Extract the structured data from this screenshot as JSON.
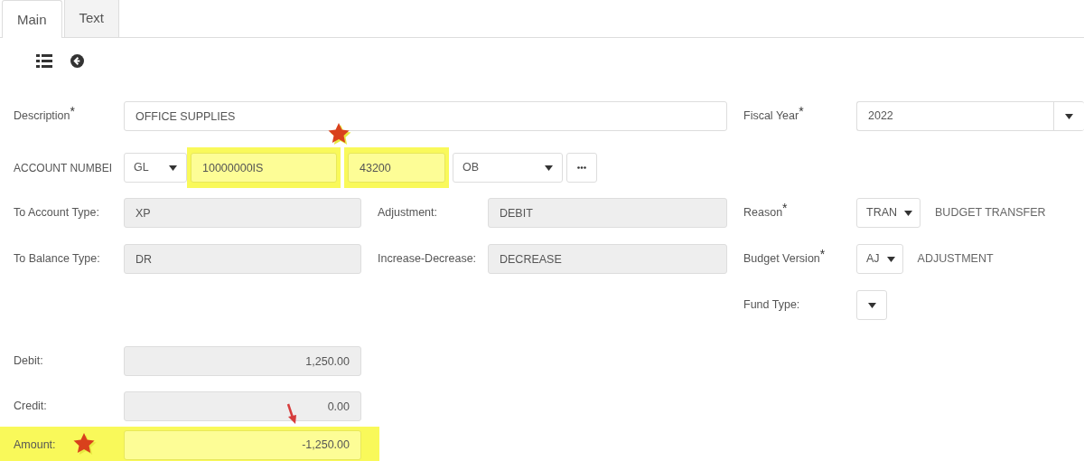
{
  "tabs": [
    {
      "label": "Main",
      "selected": true
    },
    {
      "label": "Text",
      "selected": false
    }
  ],
  "toolbar": [
    {
      "kind": "list"
    },
    {
      "kind": "back"
    }
  ],
  "description": {
    "label": "Description$^{*}$",
    "value": "OFFICE SUPPLIES"
  },
  "fiscal_year": {
    "label": "Fiscal Year$^{*}$",
    "value": "2022"
  },
  "account_number": {
    "label": "ACCOUNT NUMBEI",
    "segments": [
      {
        "kind": "select",
        "value": "GL",
        "highlighted": false
      },
      {
        "kind": "text",
        "value": "10000000IS",
        "highlighted": true
      },
      {
        "kind": "text",
        "value": "43200",
        "highlighted": true
      },
      {
        "kind": "select",
        "value": "OB",
        "highlighted": false
      },
      {
        "kind": "more"
      }
    ]
  },
  "to_account_type": {
    "label": "To Account Type:",
    "value": "XP",
    "readonly": true
  },
  "adjustment": {
    "label": "Adjustment:",
    "value": "DEBIT",
    "readonly": true
  },
  "reason": {
    "label": "Reason$^{*}$",
    "code": "TRAN",
    "text": "BUDGET TRANSFER"
  },
  "to_balance_type": {
    "label": "To Balance Type:",
    "value": "DR",
    "readonly": true
  },
  "increase_decrease": {
    "label": "Increase-Decrease:",
    "value": "DECREASE",
    "readonly": true
  },
  "budget_version": {
    "label": "Budget Version$^{*}$",
    "code": "AJ",
    "text": "ADJUSTMENT"
  },
  "fund_type": {
    "label": "Fund Type:"
  },
  "debit": {
    "label": "Debit:",
    "value": "1,250.00",
    "readonly": true,
    "highlighted": false
  },
  "credit": {
    "label": "Credit:",
    "value": "0.00",
    "readonly": true,
    "highlighted": false
  },
  "amount": {
    "label": "Amount:",
    "value": "-1,250.00",
    "highlighted": true
  }
}
